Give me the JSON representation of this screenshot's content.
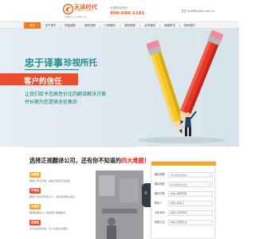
{
  "header": {
    "logo_cn": "天译时代",
    "logo_en": "TIANYI TIMES",
    "logo_sub": "中国翻译公司·北京翻译公司",
    "hotline_label": "全国服务热线：",
    "hotline_number": "400-080-1181",
    "email": "info@tysd.com.cn",
    "mail_icon": "envelope-icon"
  },
  "nav": {
    "items": [
      "首页",
      "关于我们",
      "质量保障",
      "服务流程",
      "口译服务",
      "服务领域",
      "合作案例",
      "新闻资讯",
      "联系我们"
    ],
    "active_index": 0,
    "accent_color": "#ef7d22"
  },
  "banner": {
    "title_part1": "忠于译事",
    "title_part2": "珍视所托",
    "ribbon_text": "客户的信任",
    "desc_line1": "让我们给予您高性价比的翻译解决方案",
    "desc_line2": "并长期为您提供无忧售后",
    "theme_color": "#1e8e8c",
    "ribbon_color": "#e94e2e"
  },
  "lower": {
    "question_prefix": "选择正规翻译公司，还有你不知道的",
    "question_highlight": "四大难题！",
    "items": [
      {
        "tag": "无资质",
        "desc": "翻译公司无资质，盖章无效且无法备案"
      },
      {
        "tag": "不专业",
        "desc": "翻译人员水平参差不齐，译文质量难以保证"
      },
      {
        "tag": "不准时",
        "desc": "翻译延期交付，耽误客户重要事务"
      },
      {
        "tag": "无售后",
        "desc": "交付后出现问题，无人负责售后服务"
      }
    ]
  },
  "form": {
    "fields": [
      {
        "label": "翻译语种",
        "type": "select",
        "value": "请选择翻译语种"
      },
      {
        "label": "翻译类型",
        "type": "select",
        "value": "请选择翻译类型"
      },
      {
        "label": "翻译字数",
        "type": "input",
        "placeholder": "请输入翻译字数"
      },
      {
        "label": "联系人",
        "type": "input",
        "placeholder": "请输入联系人"
      },
      {
        "label": "手机号码",
        "type": "input",
        "placeholder": "请输入手机号码"
      },
      {
        "label": "所属行业",
        "type": "input",
        "placeholder": "请输入所属行业"
      }
    ]
  },
  "side_tab": {
    "label": "不"
  }
}
